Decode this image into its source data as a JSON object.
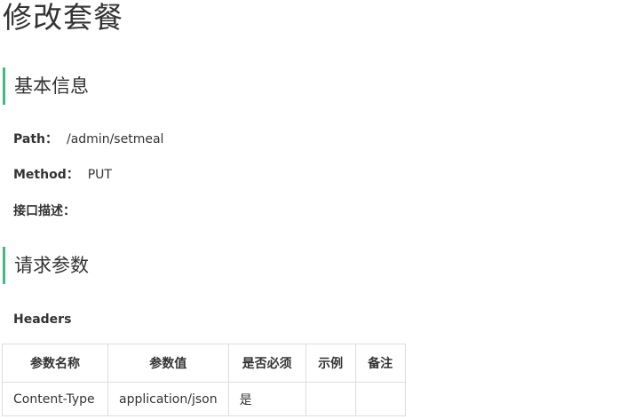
{
  "page": {
    "title": "修改套餐"
  },
  "basic_info": {
    "heading": "基本信息",
    "path_label": "Path：",
    "path_value": "/admin/setmeal",
    "method_label": "Method：",
    "method_value": "PUT",
    "desc_label": "接口描述："
  },
  "request_params": {
    "heading": "请求参数",
    "headers_label": "Headers",
    "table": {
      "columns": [
        "参数名称",
        "参数值",
        "是否必须",
        "示例",
        "备注"
      ],
      "rows": [
        [
          "Content-Type",
          "application/json",
          "是",
          "",
          ""
        ]
      ]
    }
  },
  "colors": {
    "accent": "#42b983",
    "text": "#333333",
    "border": "#dddddd"
  }
}
